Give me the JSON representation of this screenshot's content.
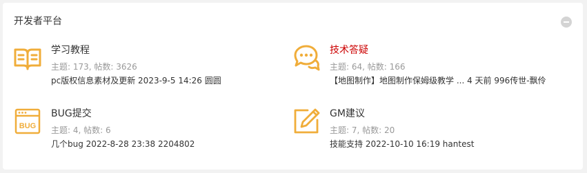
{
  "panel": {
    "title": "开发者平台"
  },
  "icons": {
    "accent_color": "#f0ad3a"
  },
  "forums": [
    {
      "name": "学习教程",
      "icon": "book-icon",
      "stats": "主题: 173, 帖数: 3626",
      "last_title": "pc版权信息素材及更新",
      "last_meta": "2023-9-5 14:26 圆圆"
    },
    {
      "name": "技术答疑",
      "icon": "chat-bubbles-icon",
      "name_color": "#cc0000",
      "stats": "主题: 64, 帖数: 166",
      "last_title": "【地图制作】地图制作保姆级教学 ...",
      "last_meta": "4 天前 996传世-飘伶"
    },
    {
      "name": "BUG提交",
      "icon": "bug-window-icon",
      "icon_label": "BUG",
      "stats": "主题: 4, 帖数: 6",
      "last_title": "几个bug",
      "last_meta": "2022-8-28 23:38 2204802"
    },
    {
      "name": "GM建议",
      "icon": "edit-pencil-icon",
      "stats": "主题: 7, 帖数: 20",
      "last_title": "技能支持",
      "last_meta": "2022-10-10 16:19 hantest"
    }
  ]
}
